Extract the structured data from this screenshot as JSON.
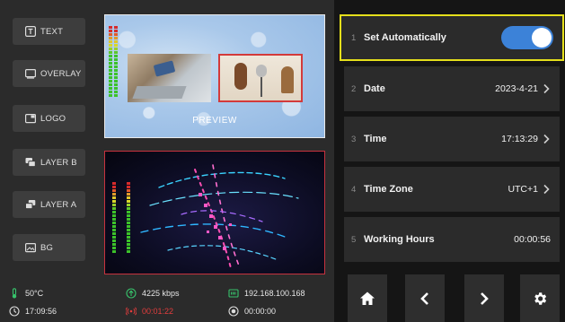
{
  "layers": [
    {
      "label": "TEXT",
      "icon": "text-icon"
    },
    {
      "label": "OVERLAY",
      "icon": "overlay-icon"
    },
    {
      "label": "LOGO",
      "icon": "logo-icon"
    },
    {
      "label": "LAYER B",
      "icon": "layer-b-icon"
    },
    {
      "label": "LAYER A",
      "icon": "layer-a-icon"
    },
    {
      "label": "BG",
      "icon": "background-image-icon"
    }
  ],
  "preview": {
    "label": "PREVIEW"
  },
  "status": {
    "temperature": "50°C",
    "clock": "17:09:56",
    "bitrate": "4225 kbps",
    "live_time": "00:01:22",
    "ip": "192.168.100.168",
    "record_time": "00:00:00"
  },
  "settings": {
    "rows": [
      {
        "num": "1",
        "label": "Set Automatically",
        "toggle_on": true
      },
      {
        "num": "2",
        "label": "Date",
        "value": "2023-4-21"
      },
      {
        "num": "3",
        "label": "Time",
        "value": "17:13:29"
      },
      {
        "num": "4",
        "label": "Time Zone",
        "value": "UTC+1"
      },
      {
        "num": "5",
        "label": "Working Hours",
        "value": "00:00:56"
      }
    ]
  },
  "nav": [
    "home-icon",
    "chevron-left-icon",
    "chevron-right-icon",
    "gear-icon"
  ],
  "colors": {
    "accent_blue": "#3c82d8",
    "highlight_yellow": "#e5df1b",
    "program_red": "#c7323e",
    "status_green": "#37c26b",
    "status_red": "#e23d3d"
  }
}
